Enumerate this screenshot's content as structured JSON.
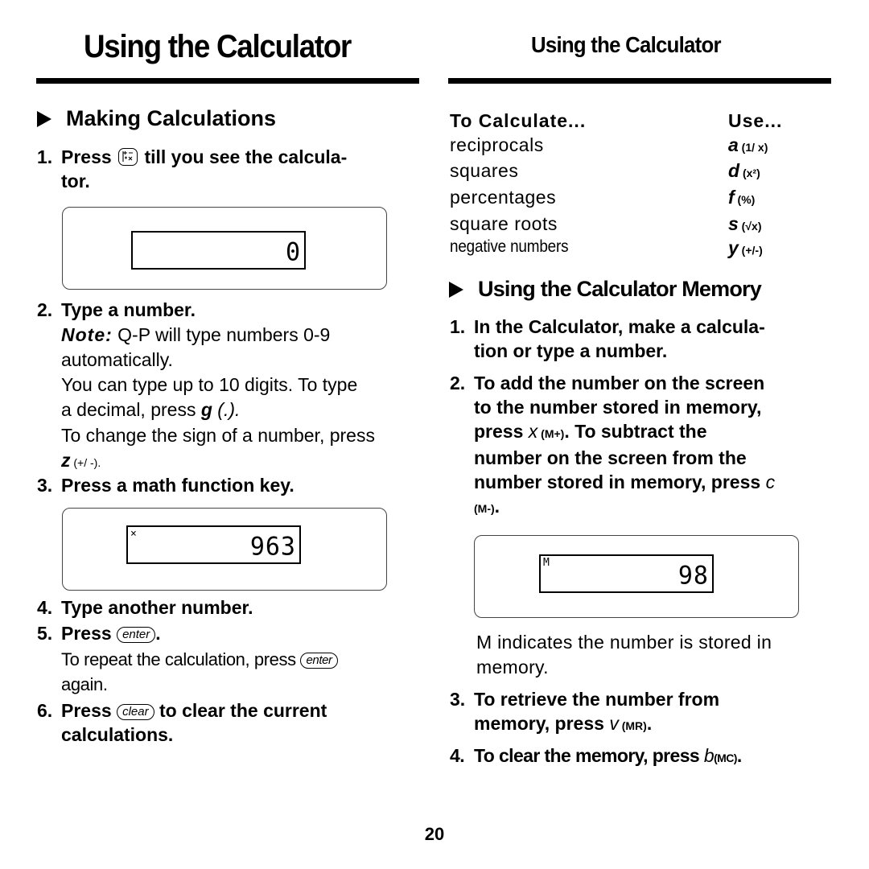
{
  "header": {
    "title_left": "Using the Calculator",
    "title_right": "Using the Calculator"
  },
  "left": {
    "section_title": "Making Calculations",
    "step1": {
      "num": "1.",
      "before": "Press",
      "after": "till you see the calcula-",
      "cont": "tor.",
      "key_icon": "calculator-key-icon"
    },
    "lcd1": {
      "value": "0",
      "indicator": ""
    },
    "step2": {
      "num": "2.",
      "text": "Type a number.",
      "note_label": "Note:",
      "note_text": " Q-P will type numbers 0-9",
      "note_cont": "automatically.",
      "digits_line1": "You can type up to 10 digits. To type",
      "digits_line2_before": "a decimal, press ",
      "decimal_key": "g",
      "decimal_sym": " (.).",
      "sign_line": "To change the sign of a number, press",
      "sign_key": "z",
      "sign_sym": " (+/ -)."
    },
    "step3": {
      "num": "3.",
      "text": "Press a math function key."
    },
    "lcd2": {
      "value": "963",
      "indicator": "×"
    },
    "step4": {
      "num": "4.",
      "text": "Type another number."
    },
    "step5": {
      "num": "5.",
      "before": "Press",
      "key": "enter",
      "after": ".",
      "repeat_before": "To repeat the calculation, press",
      "repeat_key": "enter",
      "repeat_after": "again."
    },
    "step6": {
      "num": "6.",
      "before": "Press",
      "key": "clear",
      "after": "to clear the current",
      "cont": "calculations."
    }
  },
  "right": {
    "table": {
      "headers": [
        "To Calculate...",
        "Use..."
      ],
      "rows": [
        {
          "label": "reciprocals",
          "key": "a",
          "sym": " (1/ x)"
        },
        {
          "label": "squares",
          "key": "d",
          "sym": " (x²)"
        },
        {
          "label": "percentages",
          "key": "f",
          "sym": " (%)"
        },
        {
          "label": "square roots",
          "key": "s",
          "sym": " (√x)"
        },
        {
          "label": "negative numbers",
          "key": "y",
          "sym": " (+/-)"
        }
      ]
    },
    "section_title": "Using the Calculator Memory",
    "step1": {
      "num": "1.",
      "line1": "In the Calculator, make a calcula-",
      "line2": "tion or type a number."
    },
    "step2": {
      "num": "2.",
      "line1": "To add the number on the screen",
      "line2": "to the number stored in memory,",
      "line3_before": "press ",
      "add_key": "x",
      "add_sym": " (M+)",
      "line3_after": ". To subtract the",
      "line4": "number on the screen from the",
      "line5_before": "number stored in memory, press ",
      "sub_key": "c",
      "sub_sym": "(M-)",
      "line6_after": "."
    },
    "lcd": {
      "value": "98",
      "indicator": "M"
    },
    "m_note_line1": "M indicates the number is stored in",
    "m_note_line2": "memory.",
    "step3": {
      "num": "3.",
      "line1": "To retrieve the number from",
      "line2_before": "memory, press ",
      "key": "v",
      "sym": " (MR)",
      "after": "."
    },
    "step4": {
      "num": "4.",
      "before": "To clear the memory, press ",
      "key": "b",
      "sym": "(MC)",
      "after": "."
    }
  },
  "footer": {
    "page_number": "20"
  }
}
